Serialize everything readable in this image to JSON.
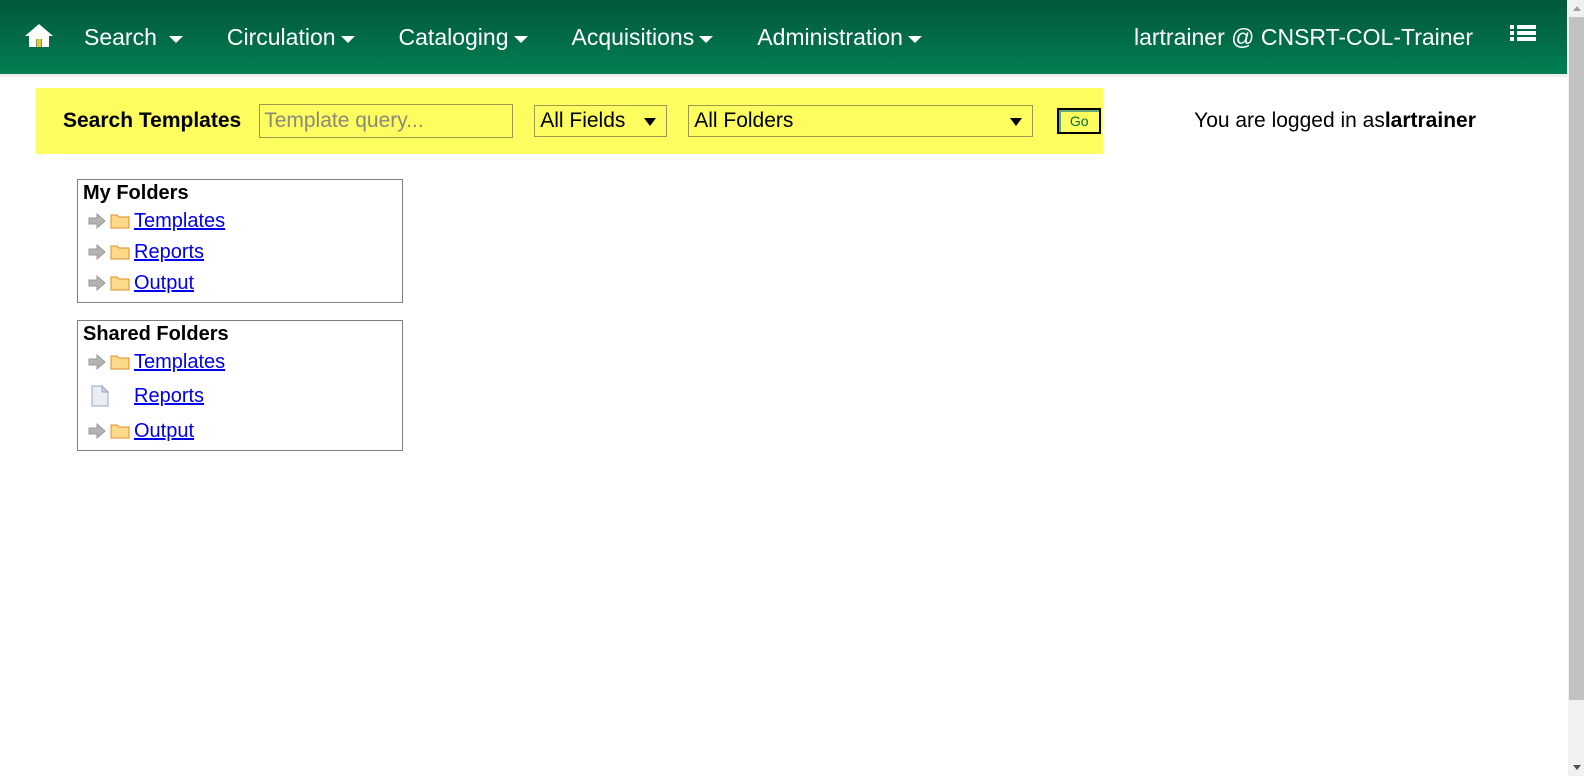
{
  "navbar": {
    "home_icon": "home-icon",
    "items": [
      {
        "label": "Search",
        "icon": "chevron-down-icon"
      },
      {
        "label": "Circulation",
        "icon": "chevron-down-icon"
      },
      {
        "label": "Cataloging",
        "icon": "chevron-down-icon"
      },
      {
        "label": "Acquisitions",
        "icon": "chevron-down-icon"
      },
      {
        "label": "Administration",
        "icon": "chevron-down-icon"
      }
    ],
    "user_workstation": "lartrainer @ CNSRT-COL-Trainer",
    "list_icon": "list-icon",
    "bg_color_top": "#01593c",
    "bg_color_bottom": "#018052"
  },
  "search": {
    "label": "Search Templates",
    "placeholder": "Template query...",
    "value": "",
    "field_select": {
      "selected": "All Fields",
      "options": [
        "All Fields"
      ]
    },
    "folder_select": {
      "selected": "All Folders",
      "options": [
        "All Folders"
      ]
    },
    "go_label": "Go",
    "bar_color": "#fdfd60"
  },
  "status": {
    "logged_in_prefix": "You are logged in as ",
    "logged_in_user": "lartrainer"
  },
  "panels": [
    {
      "title": "My Folders",
      "rows": [
        {
          "icon": "arrow-right-icon",
          "icon2": "folder-icon",
          "label": "Templates"
        },
        {
          "icon": "arrow-right-icon",
          "icon2": "folder-icon",
          "label": "Reports"
        },
        {
          "icon": "arrow-right-icon",
          "icon2": "folder-icon",
          "label": "Output"
        }
      ]
    },
    {
      "title": "Shared Folders",
      "rows": [
        {
          "icon": "arrow-right-icon",
          "icon2": "folder-icon",
          "label": "Templates"
        },
        {
          "icon": "document-icon",
          "icon2": "",
          "label": "Reports"
        },
        {
          "icon": "arrow-right-icon",
          "icon2": "folder-icon",
          "label": "Output"
        }
      ]
    }
  ],
  "link_color": "#0000ee"
}
